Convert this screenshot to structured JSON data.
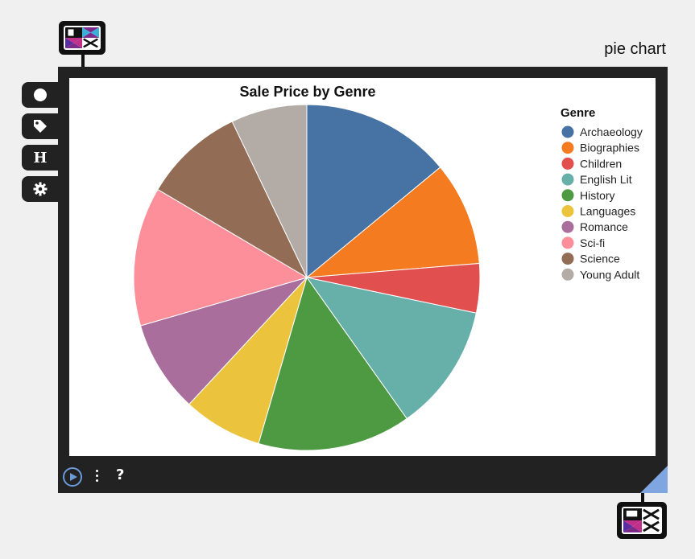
{
  "frame": {
    "label": "pie chart"
  },
  "toolbar": {
    "items": [
      {
        "name": "circle-tool",
        "icon": "circle-icon"
      },
      {
        "name": "tag-tool",
        "icon": "tag-icon"
      },
      {
        "name": "header-tool",
        "icon": "heading-icon",
        "glyph": "H"
      },
      {
        "name": "settings-tool",
        "icon": "gear-icon"
      }
    ]
  },
  "bottombar": {
    "help_label": "?"
  },
  "colors": {
    "frame": "#222222",
    "accent": "#7fa6e0",
    "play": "#6a9ad8"
  },
  "chart_data": {
    "type": "pie",
    "title": "Sale Price by Genre",
    "legend_title": "Genre",
    "legend_position": "top-right",
    "categories": [
      "Archaeology",
      "Biographies",
      "Children",
      "English Lit",
      "History",
      "Languages",
      "Romance",
      "Sci-fi",
      "Science",
      "Young Adult"
    ],
    "values": [
      14.0,
      9.7,
      4.6,
      11.9,
      14.3,
      7.4,
      8.6,
      13.0,
      9.4,
      7.1
    ],
    "colors": [
      "#4672a4",
      "#f47b20",
      "#e14f4f",
      "#67afa9",
      "#4d9a43",
      "#ecc33c",
      "#a96e9c",
      "#fd8f9b",
      "#926c55",
      "#b3aba5"
    ]
  }
}
